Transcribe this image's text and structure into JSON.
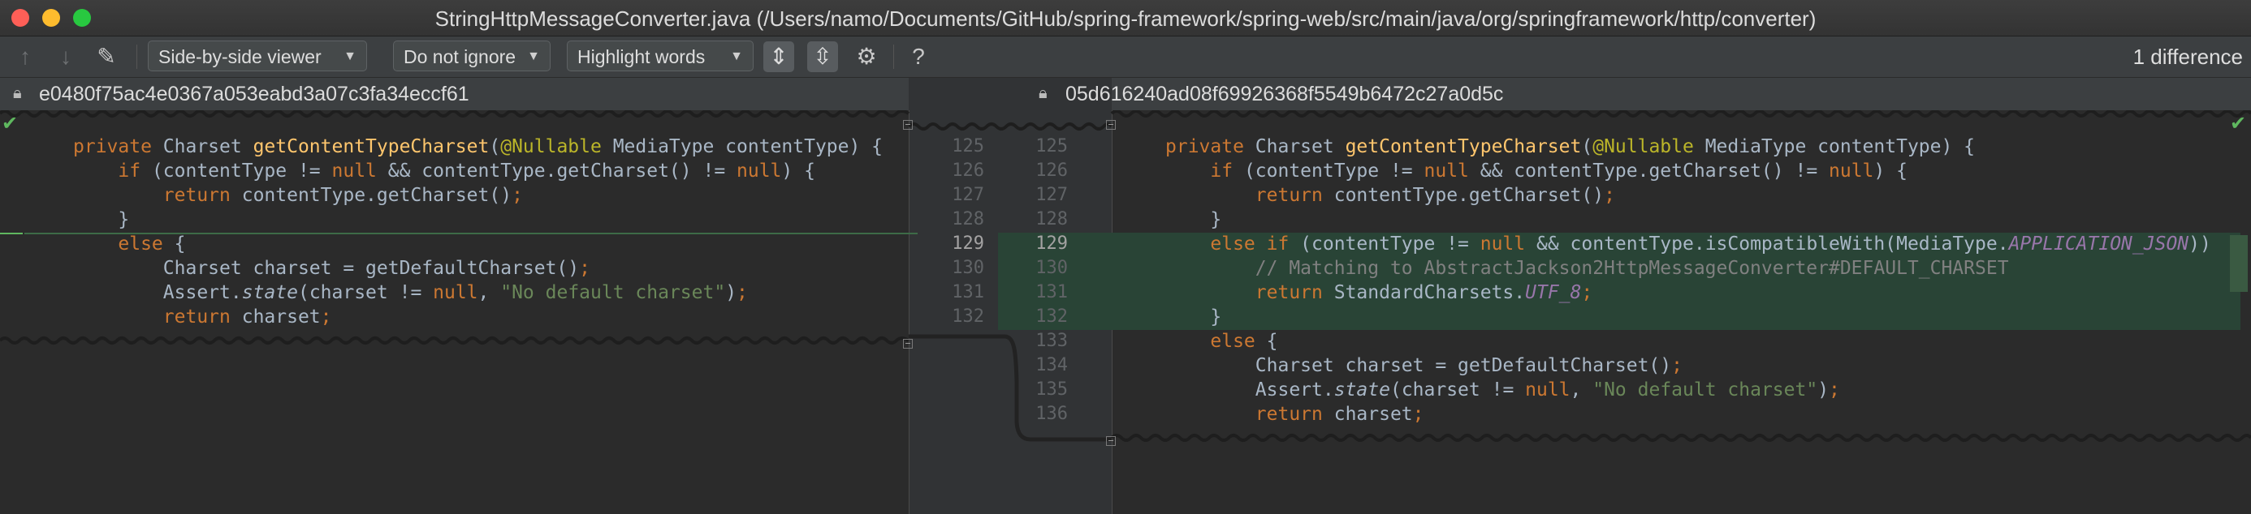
{
  "window": {
    "title": "StringHttpMessageConverter.java (/Users/namo/Documents/GitHub/spring-framework/spring-web/src/main/java/org/springframework/http/converter)"
  },
  "toolbar": {
    "viewer_mode": "Side-by-side viewer",
    "ignore_mode": "Do not ignore",
    "highlight_mode": "Highlight words",
    "difference_count": "1 difference",
    "help_label": "?"
  },
  "left": {
    "revision": "e0480f75ac4e0367a053eabd3a07c3fa34eccf61",
    "line_numbers": [
      "125",
      "126",
      "127",
      "128",
      "129",
      "130",
      "131",
      "132"
    ]
  },
  "right": {
    "revision": "05d616240ad08f69926368f5549b6472c27a0d5c",
    "line_numbers": [
      "125",
      "126",
      "127",
      "128",
      "129",
      "130",
      "131",
      "132",
      "133",
      "134",
      "135",
      "136"
    ]
  },
  "colors": {
    "background": "#2b2b2b",
    "inserted_highlight": "#294436",
    "keyword": "#cc7832",
    "string": "#6a8759"
  }
}
